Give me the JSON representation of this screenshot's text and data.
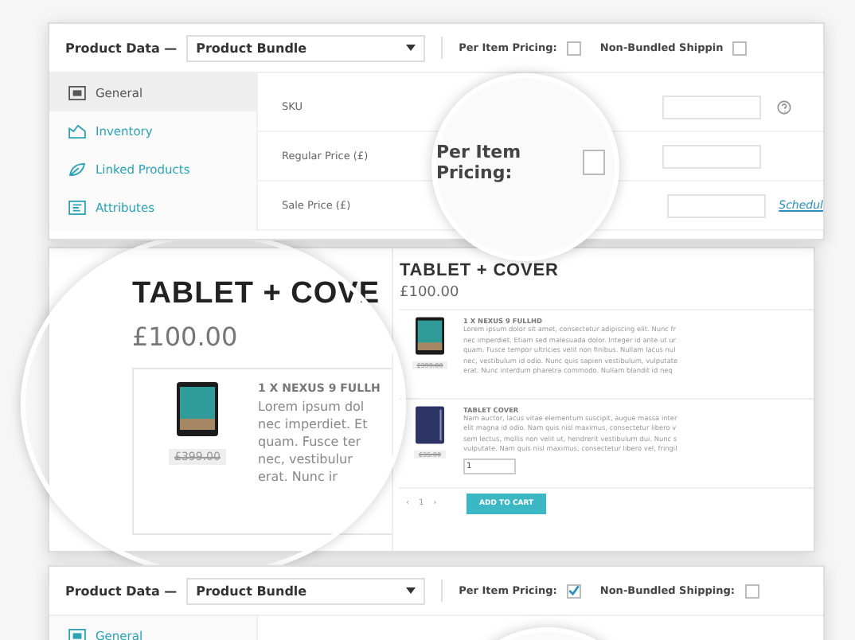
{
  "top_panel": {
    "title": "Product Data —",
    "product_type": "Product Bundle",
    "options": [
      {
        "label": "Per Item Pricing:",
        "checked": false
      },
      {
        "label": "Non-Bundled Shippin",
        "checked": false
      }
    ],
    "sidebar": [
      {
        "label": "General",
        "selected": true
      },
      {
        "label": "Inventory",
        "selected": false
      },
      {
        "label": "Linked Products",
        "selected": false
      },
      {
        "label": "Attributes",
        "selected": false
      }
    ],
    "fields": [
      {
        "label": "SKU"
      },
      {
        "label": "Regular Price (£)"
      },
      {
        "label": "Sale Price (£)",
        "link": "Schedul"
      }
    ],
    "magnifier": {
      "label": "Per Item Pricing:",
      "checked": false
    }
  },
  "preview": {
    "zoomed": {
      "title": "TABLET + COVE",
      "price": "£100.00",
      "item": {
        "title": "1 X NEXUS 9 FULLH",
        "old_price": "£399.00",
        "lines": [
          "Lorem ipsum dol",
          "nec imperdiet. Et",
          "quam. Fusce ter",
          "nec, vestibulur",
          "erat. Nunc ir"
        ]
      }
    },
    "title": "TABLET + COVER",
    "price": "£100.00",
    "items": [
      {
        "title": "1 X NEXUS 9 FULLHD",
        "old_price": "£399.00",
        "lines": [
          "Lorem ipsum dolor sit amet, consectetur adipiscing elit. Nunc fr",
          "nec imperdiet. Etiam sed malesuada dolor. Integer id ante ut ur",
          "quam. Fusce tempor ultricies velit non finibus. Nullam lacus nul",
          "nec, vestibulum id odio. Nunc quis sapien vestibulum, vulputate",
          "erat. Nunc interdum pharetra commodo. Nullam blandit id neq"
        ]
      },
      {
        "title": "TABLET COVER",
        "old_price": "£35.00",
        "lines": [
          "Nam auctor, lacus vitae elementum suscipit, augue massa inter",
          "elit magna id odio. Nam quis nisl maximus, consectetur libero v",
          "sem lectus, mollis non velit ut, hendrerit vestibulum dui. Nunc s",
          "vulputate. Nam quis nisl maximus, consectetur libero vel, fringil"
        ],
        "quantity": "1"
      }
    ],
    "pager": [
      "‹",
      "1",
      "›"
    ],
    "add_to_cart": "ADD TO CART"
  },
  "bottom_panel": {
    "title": "Product Data —",
    "product_type": "Product Bundle",
    "options": [
      {
        "label": "Per Item Pricing:",
        "checked": true
      },
      {
        "label": "Non-Bundled Shipping:",
        "checked": false
      }
    ],
    "sidebar": [
      {
        "label": "General",
        "selected": false
      }
    ]
  }
}
